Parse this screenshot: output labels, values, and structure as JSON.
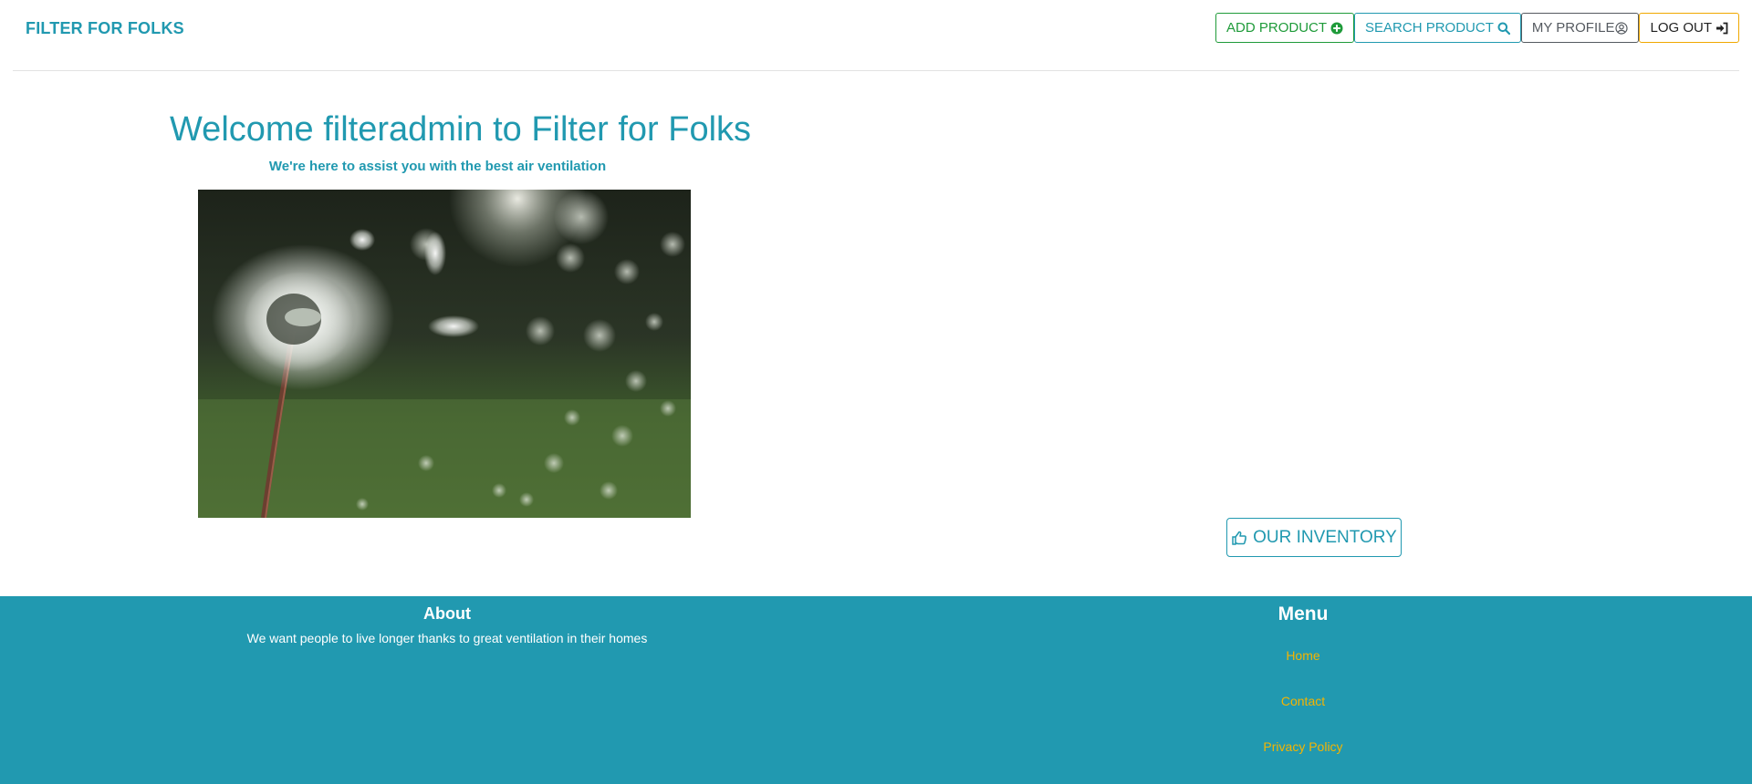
{
  "nav": {
    "brand": "FILTER FOR FOLKS",
    "add_product": "ADD PRODUCT",
    "search_product": "SEARCH PRODUCT",
    "my_profile": "MY PROFILE",
    "log_out": "LOG OUT"
  },
  "hero": {
    "title": "Welcome filteradmin to Filter for Folks",
    "subtitle": "We're here to assist you with the best air ventilation",
    "image_alt": "dandelion seeds blowing"
  },
  "inventory_button": "OUR INVENTORY",
  "footer": {
    "about_heading": "About",
    "about_text": "We want people to live longer thanks to great ventilation in their homes",
    "menu_heading": "Menu",
    "links": [
      "Home",
      "Contact",
      "Privacy Policy"
    ]
  },
  "colors": {
    "accent": "#2199b0",
    "success": "#1f9b3a",
    "warning": "#f0a800",
    "link": "#f5b400",
    "secondary": "#555a60"
  },
  "icons": {
    "add_product": "plus-circle-icon",
    "search_product": "search-icon",
    "my_profile": "user-circle-icon",
    "log_out": "sign-in-icon",
    "inventory": "thumbs-up-icon"
  }
}
